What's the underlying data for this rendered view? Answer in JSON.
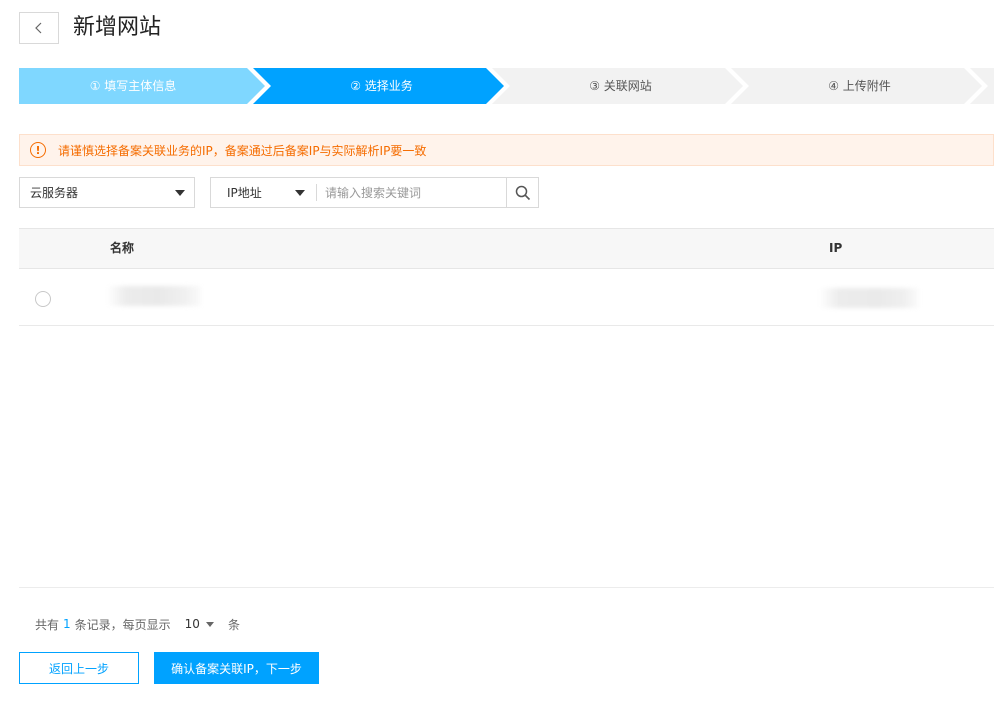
{
  "header": {
    "back_icon": "chevron-left-icon",
    "title": "新增网站"
  },
  "steps": [
    {
      "label": "① 填写主体信息",
      "state": "done",
      "color": "#7fd7ff"
    },
    {
      "label": "② 选择业务",
      "state": "active",
      "color": "#00a2ff"
    },
    {
      "label": "③ 关联网站",
      "state": "pending",
      "color": "#f2f2f2"
    },
    {
      "label": "④ 上传附件",
      "state": "pending",
      "color": "#f2f2f2"
    }
  ],
  "alert": {
    "icon": "warning-circle-icon",
    "text": "请谨慎选择备案关联业务的IP，备案通过后备案IP与实际解析IP要一致"
  },
  "filters": {
    "product_select": "云服务器",
    "field_select": "IP地址",
    "search_placeholder": "请输入搜索关键词",
    "search_icon": "search-icon"
  },
  "table": {
    "columns": [
      "名称",
      "IP"
    ],
    "rows": [
      {
        "name": "",
        "ip": "",
        "selected": false
      }
    ]
  },
  "pagination": {
    "prefix": "共有",
    "total": "1",
    "middle": "条记录，每页显示",
    "page_size": "10",
    "suffix": "条"
  },
  "footer": {
    "prev_label": "返回上一步",
    "next_label": "确认备案关联IP，下一步"
  },
  "colors": {
    "primary": "#00a2ff",
    "step_done": "#7fd7ff",
    "step_pending": "#f2f2f2",
    "warning": "#f56c00",
    "warning_bg": "#fff3eb"
  }
}
